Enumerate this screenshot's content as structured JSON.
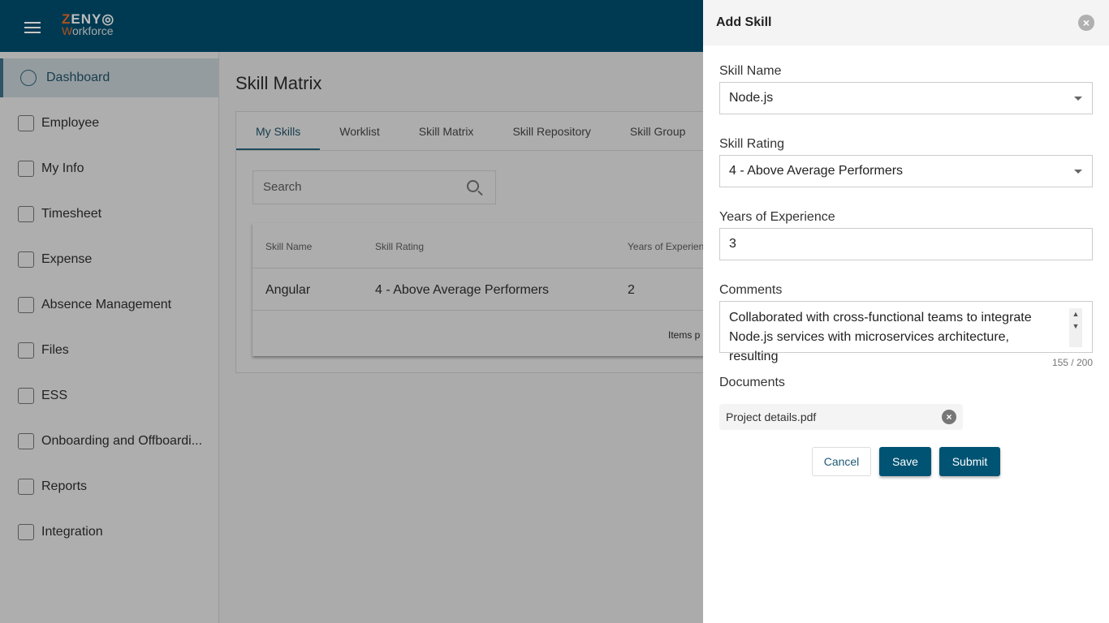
{
  "header": {
    "logo_top": "ZENY",
    "logo_bottom": "Workforce"
  },
  "sidebar": {
    "items": [
      {
        "label": "Dashboard",
        "icon": "pie-chart-icon",
        "active": true
      },
      {
        "label": "Employee",
        "icon": "user-icon"
      },
      {
        "label": "My Info",
        "icon": "user-icon"
      },
      {
        "label": "Timesheet",
        "icon": "clock-icon"
      },
      {
        "label": "Expense",
        "icon": "money-icon"
      },
      {
        "label": "Absence Management",
        "icon": "door-icon"
      },
      {
        "label": "Files",
        "icon": "file-icon"
      },
      {
        "label": "ESS",
        "icon": "monitor-icon"
      },
      {
        "label": "Onboarding and Offboardi...",
        "icon": "id-card-icon"
      },
      {
        "label": "Reports",
        "icon": "report-icon"
      },
      {
        "label": "Integration",
        "icon": "report-icon"
      }
    ]
  },
  "main": {
    "title": "Skill Matrix",
    "tabs": [
      "My Skills",
      "Worklist",
      "Skill Matrix",
      "Skill Repository",
      "Skill Group"
    ],
    "search_placeholder": "Search",
    "table": {
      "headers": [
        "Skill Name",
        "Skill Rating",
        "Years of Experienc"
      ],
      "rows": [
        [
          "Angular",
          "4 - Above Average Performers",
          "2"
        ]
      ],
      "paginator_label": "Items p"
    }
  },
  "panel": {
    "title": "Add Skill",
    "skill_name_label": "Skill Name",
    "skill_name": "Node.js",
    "skill_rating_label": "Skill Rating",
    "skill_rating": "4 - Above Average Performers",
    "years_label": "Years of Experience",
    "years": "3",
    "comments_label": "Comments",
    "comments": "Collaborated with cross-functional teams to integrate Node.js services with microservices architecture, resulting",
    "char_count": "155 / 200",
    "documents_label": "Documents",
    "document": "Project details.pdf",
    "cancel": "Cancel",
    "save": "Save",
    "submit": "Submit"
  },
  "colors": {
    "header": "#003a52",
    "primary": "#005373",
    "logo_accent": "#b0501e"
  }
}
